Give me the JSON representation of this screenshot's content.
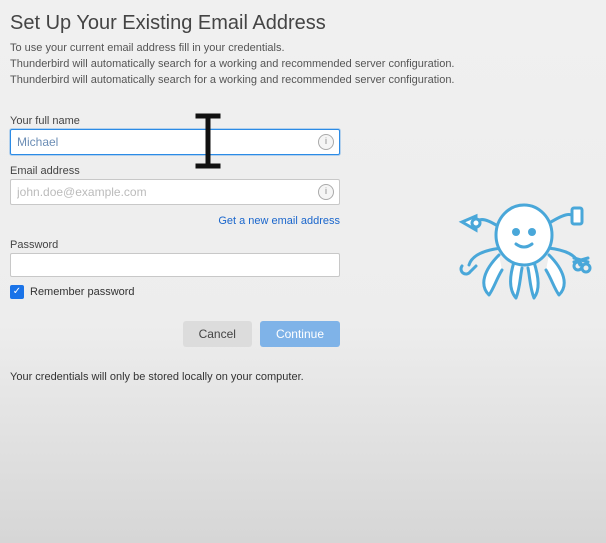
{
  "header": {
    "title": "Set Up Your Existing Email Address",
    "desc_line1": "To use your current email address fill in your credentials.",
    "desc_line2": "Thunderbird will automatically search for a working and recommended server configuration.",
    "desc_line3": "Thunderbird will automatically search for a working and recommended server configuration."
  },
  "fields": {
    "fullname_label": "Your full name",
    "fullname_value": "Michael",
    "email_label": "Email address",
    "email_placeholder": "john.doe@example.com",
    "password_label": "Password",
    "new_email_link": "Get a new email address",
    "remember_label": "Remember password",
    "remember_checked": true
  },
  "buttons": {
    "cancel": "Cancel",
    "continue": "Continue"
  },
  "footnote": "Your credentials will only be stored locally on your computer.",
  "icons": {
    "info": "i",
    "check": "✓"
  }
}
